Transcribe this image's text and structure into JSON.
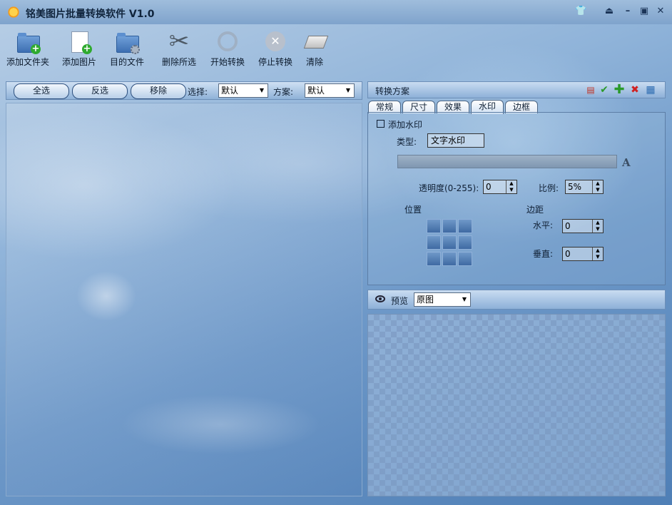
{
  "window": {
    "title": "铭美图片批量转换软件 V1.0",
    "controls": [
      "skin-icon",
      "collapse-icon",
      "minimize-icon",
      "maximize-icon",
      "close-icon"
    ]
  },
  "toolbar": {
    "add_folder": "添加文件夹",
    "add_image": "添加图片",
    "target_file": "目的文件",
    "delete_selected": "删除所选",
    "start_convert": "开始转换",
    "stop_convert": "停止转换",
    "clear": "清除"
  },
  "list_bar": {
    "select_all": "全选",
    "invert": "反选",
    "remove": "移除",
    "select_label": "选择:",
    "select_value": "默认",
    "scheme_label": "方案:",
    "scheme_value": "默认"
  },
  "scheme": {
    "title": "转换方案",
    "icons": [
      "new-scheme-icon",
      "confirm-icon",
      "add-icon",
      "delete-icon",
      "save-icon"
    ]
  },
  "tabs": [
    "常规",
    "尺寸",
    "效果",
    "水印",
    "边框"
  ],
  "active_tab": "水印",
  "watermark": {
    "enable_label": "添加水印",
    "enabled": false,
    "type_label": "类型:",
    "type_value": "文字水印",
    "transparency_label": "透明度(0-255):",
    "transparency_value": "0",
    "ratio_label": "比例:",
    "ratio_value": "5%",
    "position_label": "位置",
    "margin_label": "边距",
    "horizontal_label": "水平:",
    "horizontal_value": "0",
    "vertical_label": "垂直:",
    "vertical_value": "0",
    "font_glyph": "A"
  },
  "preview": {
    "label": "预览",
    "mode_value": "原图"
  },
  "colors": {
    "accent": "#4f7fb6",
    "titlebar": "#8fb0d6"
  }
}
